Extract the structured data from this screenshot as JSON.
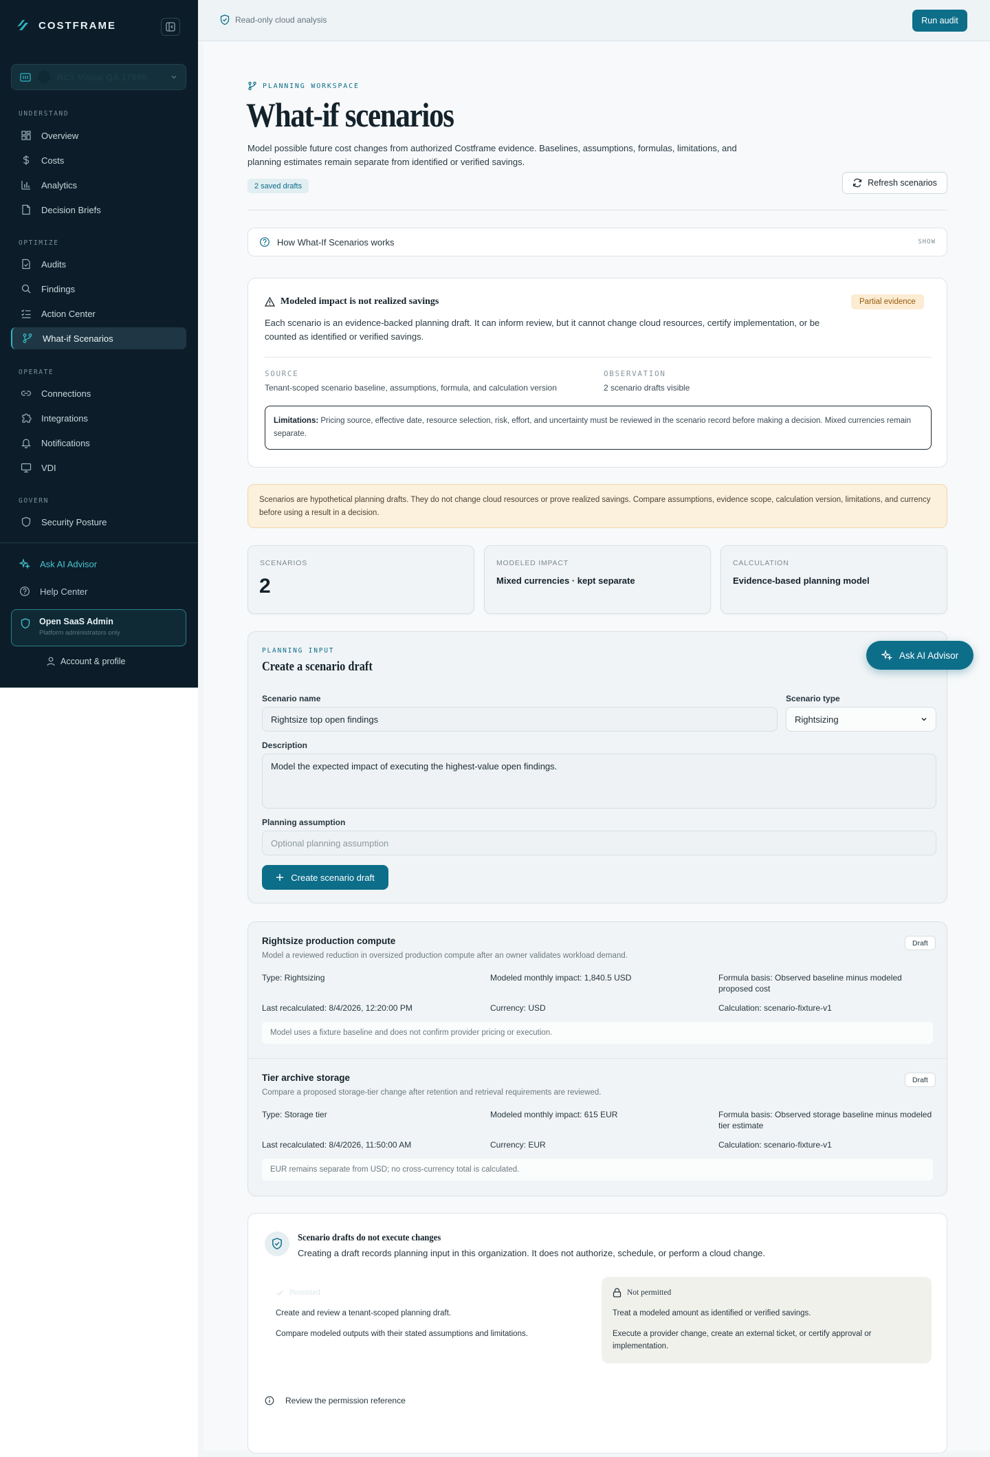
{
  "brand": {
    "name": "COSTFRAME"
  },
  "org": {
    "name": "RC1 Visual QA 17898..."
  },
  "nav": {
    "understand_label": "UNDERSTAND",
    "optimize_label": "OPTIMIZE",
    "operate_label": "OPERATE",
    "govern_label": "GOVERN",
    "items": [
      {
        "label": "Overview",
        "icon": "grid-icon"
      },
      {
        "label": "Costs",
        "icon": "dollar-icon"
      },
      {
        "label": "Analytics",
        "icon": "bar-chart-icon"
      },
      {
        "label": "Decision Briefs",
        "icon": "document-icon"
      },
      {
        "label": "Audits",
        "icon": "file-check-icon"
      },
      {
        "label": "Findings",
        "icon": "search-icon"
      },
      {
        "label": "Action Center",
        "icon": "checklist-icon"
      },
      {
        "label": "What-if Scenarios",
        "icon": "branch-icon",
        "active": true
      },
      {
        "label": "Connections",
        "icon": "link-icon"
      },
      {
        "label": "Integrations",
        "icon": "puzzle-icon"
      },
      {
        "label": "Notifications",
        "icon": "bell-icon"
      },
      {
        "label": "VDI",
        "icon": "monitor-icon"
      },
      {
        "label": "Security Posture",
        "icon": "shield-icon"
      }
    ],
    "ask_ai": "Ask AI Advisor",
    "help": "Help Center",
    "admin_title": "Open SaaS Admin",
    "admin_sub": "Platform administrators only",
    "account": "Account & profile"
  },
  "topbar": {
    "readonly": "Read-only cloud analysis",
    "run_audit": "Run audit"
  },
  "header": {
    "eyebrow": "PLANNING WORKSPACE",
    "title": "What-if scenarios",
    "description": "Model possible future cost changes from authorized Costframe evidence. Baselines, assumptions, formulas, limitations, and planning estimates remain separate from identified or verified savings.",
    "drafts_pill": "2 saved drafts",
    "refresh": "Refresh scenarios"
  },
  "how": {
    "label": "How What-If Scenarios works",
    "toggle": "SHOW"
  },
  "evidence": {
    "title": "Modeled impact is not realized savings",
    "badge": "Partial evidence",
    "body": "Each scenario is an evidence-backed planning draft. It can inform review, but it cannot change cloud resources, certify implementation, or be counted as identified or verified savings.",
    "source_label": "SOURCE",
    "source_value": "Tenant-scoped scenario baseline, assumptions, formula, and calculation version",
    "observation_label": "OBSERVATION",
    "observation_value": "2 scenario drafts visible",
    "limitations_label": "Limitations:",
    "limitations_text": "Pricing source, effective date, resource selection, risk, effort, and uncertainty must be reviewed in the scenario record before making a decision. Mixed currencies remain separate."
  },
  "notice": "Scenarios are hypothetical planning drafts. They do not change cloud resources or prove realized savings. Compare assumptions, evidence scope, calculation version, limitations, and currency before using a result in a decision.",
  "metrics": [
    {
      "label": "SCENARIOS",
      "value": "2"
    },
    {
      "label": "MODELED IMPACT",
      "value": "Mixed currencies · kept separate"
    },
    {
      "label": "CALCULATION",
      "value": "Evidence-based planning model"
    }
  ],
  "form": {
    "eyebrow": "PLANNING INPUT",
    "title": "Create a scenario draft",
    "name_label": "Scenario name",
    "name_value": "Rightsize top open findings",
    "type_label": "Scenario type",
    "type_value": "Rightsizing",
    "desc_label": "Description",
    "desc_value": "Model the expected impact of executing the highest-value open findings.",
    "assumption_label": "Planning assumption",
    "assumption_placeholder": "Optional planning assumption",
    "submit": "Create scenario draft"
  },
  "ai_float": "Ask AI Advisor",
  "scenarios": [
    {
      "title": "Rightsize production compute",
      "desc": "Model a reviewed reduction in oversized production compute after an owner validates workload demand.",
      "badge": "Draft",
      "type": "Type: Rightsizing",
      "impact": "Modeled monthly impact: 1,840.5 USD",
      "formula": "Formula basis: Observed baseline minus modeled proposed cost",
      "recalc": "Last recalculated: 8/4/2026, 12:20:00 PM",
      "currency": "Currency: USD",
      "calc": "Calculation: scenario-fixture-v1",
      "note": "Model uses a fixture baseline and does not confirm provider pricing or execution."
    },
    {
      "title": "Tier archive storage",
      "desc": "Compare a proposed storage-tier change after retention and retrieval requirements are reviewed.",
      "badge": "Draft",
      "type": "Type: Storage tier",
      "impact": "Modeled monthly impact: 615 EUR",
      "formula": "Formula basis: Observed storage baseline minus modeled tier estimate",
      "recalc": "Last recalculated: 8/4/2026, 11:50:00 AM",
      "currency": "Currency: EUR",
      "calc": "Calculation: scenario-fixture-v1",
      "note": "EUR remains separate from USD; no cross-currency total is calculated."
    }
  ],
  "permissions": {
    "title": "Scenario drafts do not execute changes",
    "subtitle": "Creating a draft records planning input in this organization. It does not authorize, schedule, or perform a cloud change.",
    "permitted_label": "Permitted",
    "permitted": [
      "Create and review a tenant-scoped planning draft.",
      "Compare modeled outputs with their stated assumptions and limitations."
    ],
    "not_permitted_label": "Not permitted",
    "not_permitted": [
      "Treat a modeled amount as identified or verified savings.",
      "Execute a provider change, create an external ticket, or certify approval or implementation."
    ],
    "reference": "Review the permission reference"
  },
  "colors": {
    "accent": "#0d6e8a",
    "sidebar": "#0c1d29",
    "warning_bg": "#fcf1dd"
  }
}
